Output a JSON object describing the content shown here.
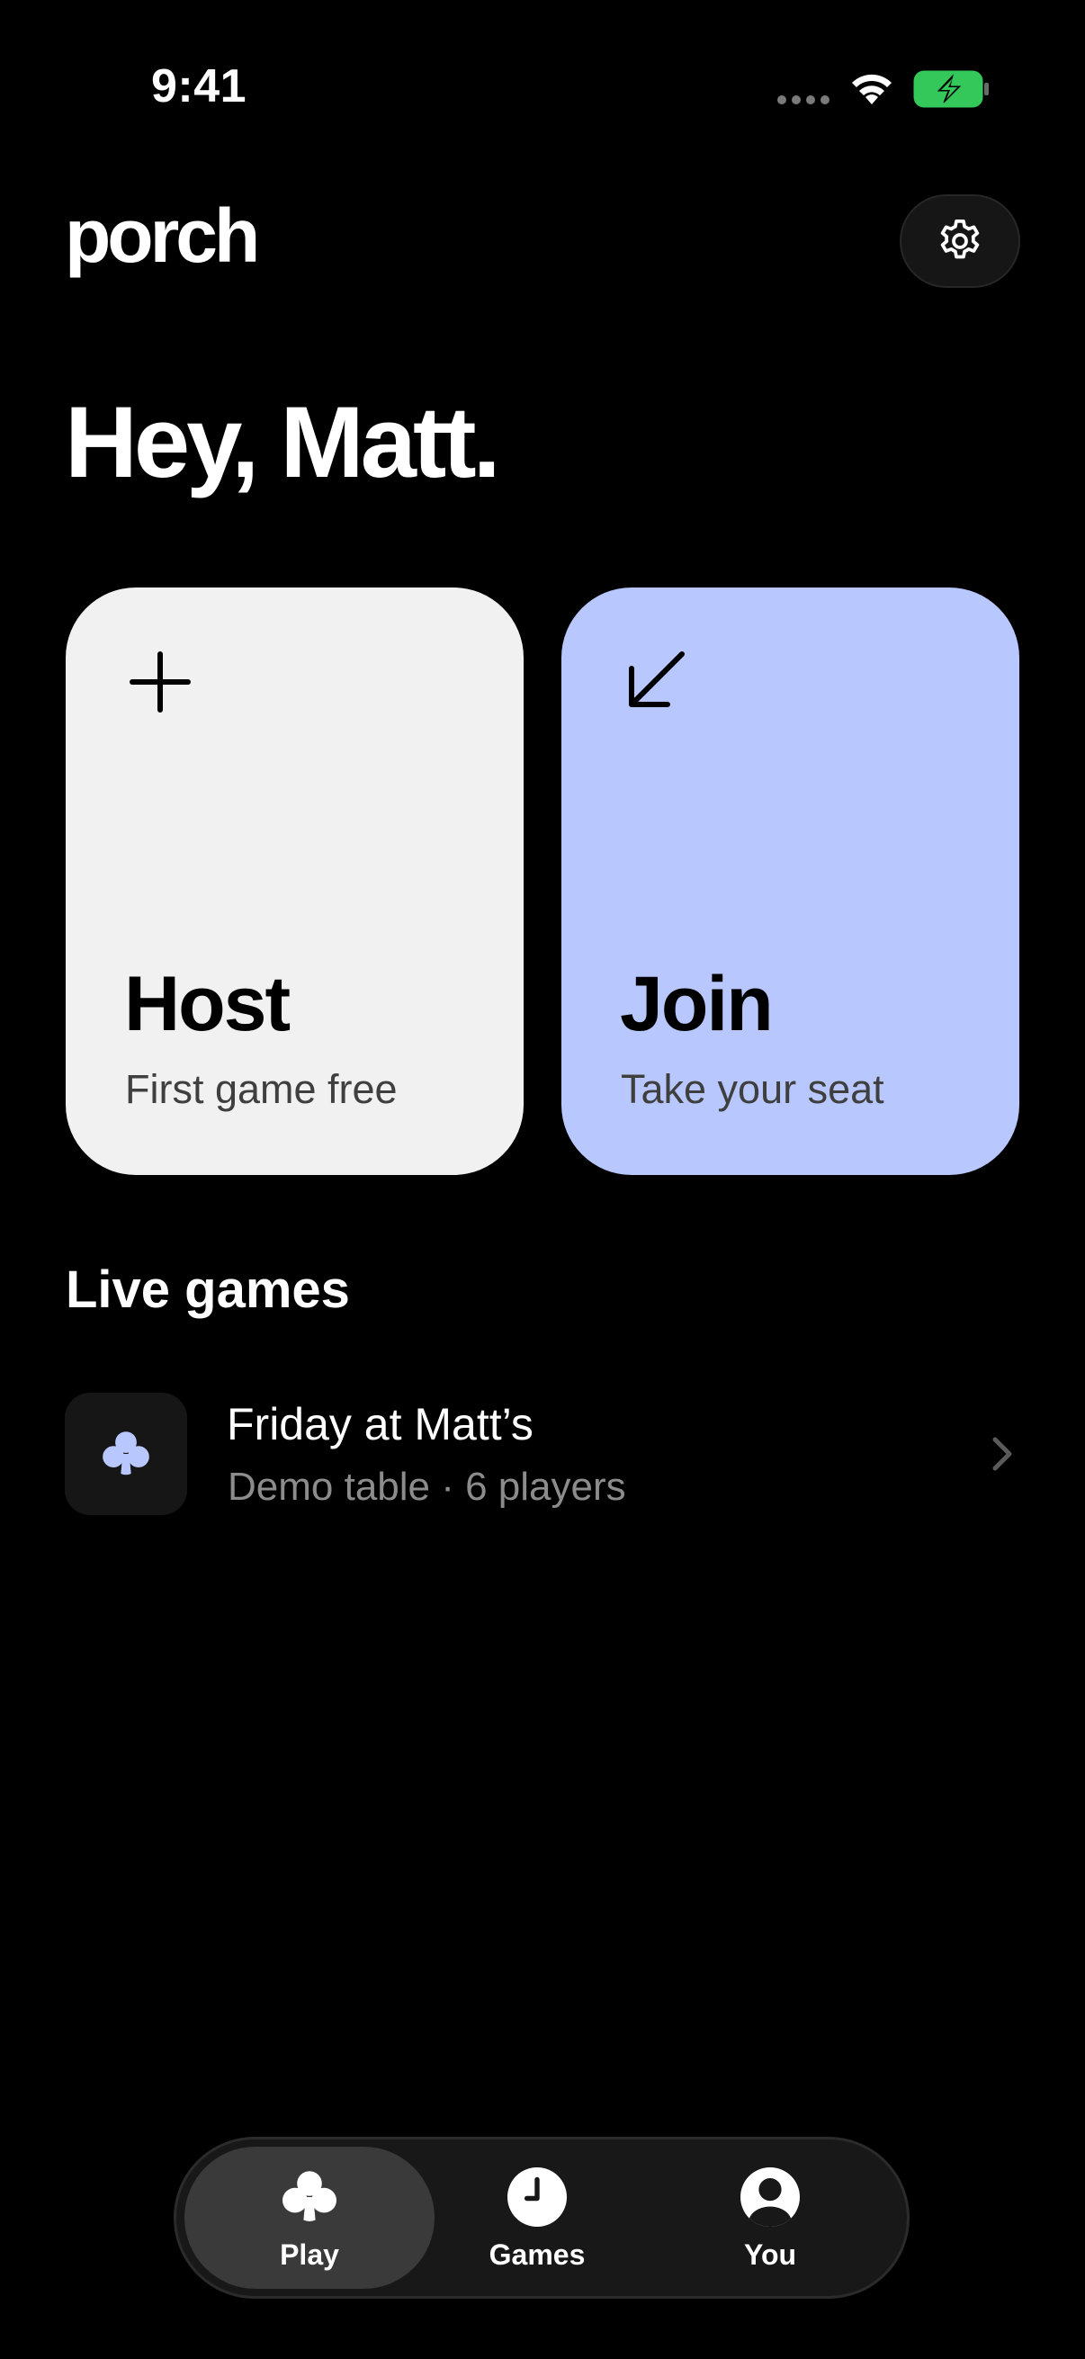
{
  "status_bar": {
    "time": "9:41"
  },
  "header": {
    "logo": "porch",
    "settings_icon": "gear-icon"
  },
  "greeting": "Hey, Matt.",
  "cards": {
    "host": {
      "title": "Host",
      "subtitle": "First game free",
      "icon": "plus-icon",
      "color": "#f1f1f1"
    },
    "join": {
      "title": "Join",
      "subtitle": "Take your seat",
      "icon": "arrow-down-left-icon",
      "color": "#b8c8ff"
    }
  },
  "live_games": {
    "title": "Live games",
    "items": [
      {
        "name": "Friday at Matt’s",
        "details": "Demo table · 6 players",
        "icon": "club-icon"
      }
    ]
  },
  "tab_bar": {
    "tabs": [
      {
        "label": "Play",
        "icon": "club-icon",
        "active": true
      },
      {
        "label": "Games",
        "icon": "clock-icon",
        "active": false
      },
      {
        "label": "You",
        "icon": "person-icon",
        "active": false
      }
    ]
  },
  "colors": {
    "background": "#000000",
    "accent": "#b8c8ff",
    "battery": "#34c759"
  }
}
